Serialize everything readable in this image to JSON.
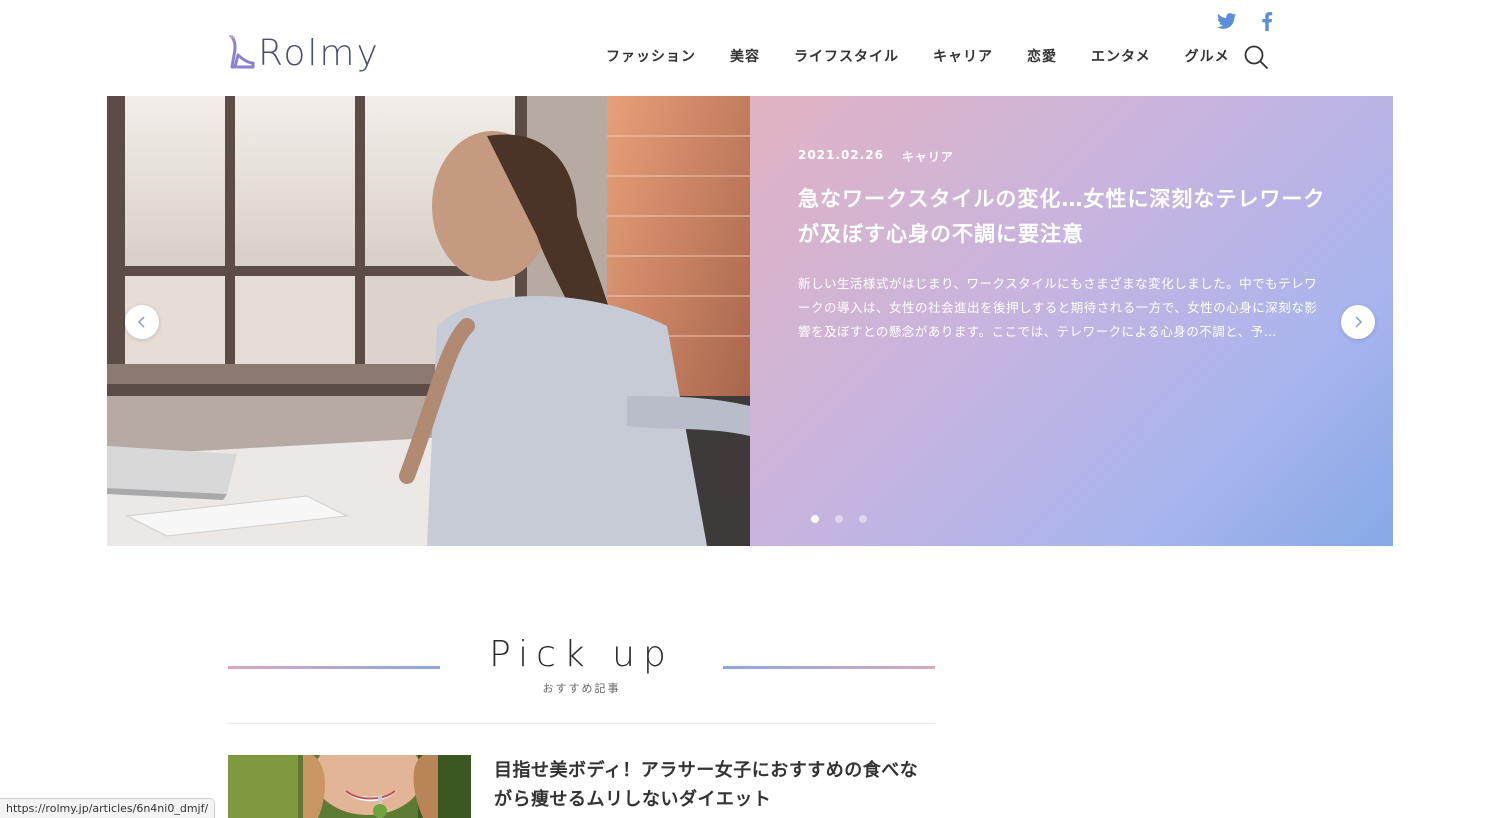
{
  "site": {
    "logo_text": "Rolmy"
  },
  "social": {
    "twitter_color": "#5b8fd8",
    "facebook_color": "#5b8fd8"
  },
  "nav": {
    "items": [
      {
        "label": "ファッション"
      },
      {
        "label": "美容"
      },
      {
        "label": "ライフスタイル"
      },
      {
        "label": "キャリア"
      },
      {
        "label": "恋愛"
      },
      {
        "label": "エンタメ"
      },
      {
        "label": "グルメ"
      }
    ]
  },
  "hero": {
    "date": "2021.02.26",
    "category": "キャリア",
    "title": "急なワークスタイルの変化…女性に深刻なテレワークが及ぼす心身の不調に要注意",
    "excerpt": "新しい生活様式がはじまり、ワークスタイルにもさまざまな変化しました。中でもテレワークの導入は、女性の社会進出を後押しすると期待される一方で、女性の心身に深刻な影響を及ぼすとの懸念があります。ここでは、テレワークによる心身の不調と、予…",
    "slides_total": 3,
    "active_slide": 1
  },
  "pickup": {
    "title": "Pick up",
    "subtitle": "おすすめ記事",
    "articles": [
      {
        "title": "目指せ美ボディ！アラサー女子におすすめの食べながら痩せるムリしないダイエット"
      }
    ]
  },
  "status_bar": {
    "url": "https://rolmy.jp/articles/6n4ni0_dmjf/"
  }
}
